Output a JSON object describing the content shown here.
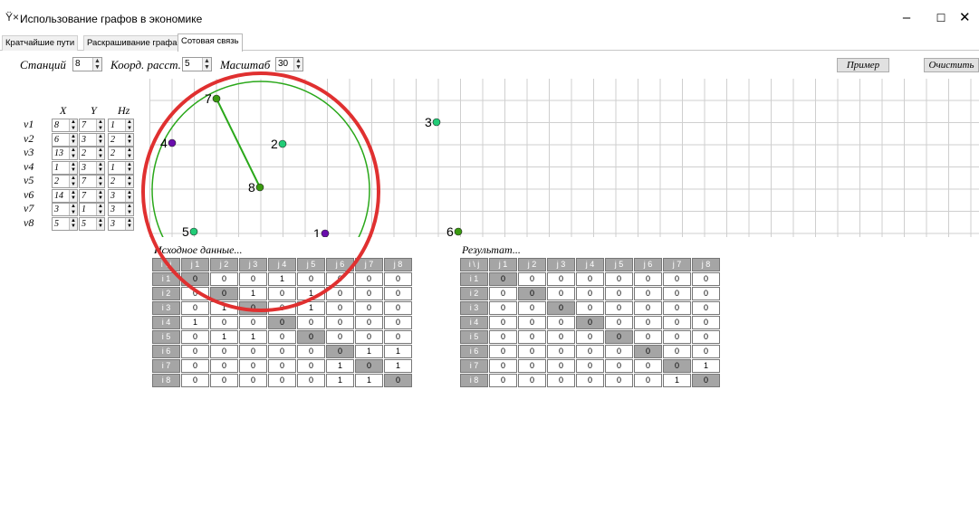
{
  "window": {
    "title": "Использование графов в экономике",
    "app_icon": "graph-app-icon",
    "minimize": "–",
    "maximize": "☐",
    "close": "✕"
  },
  "tabs": [
    "Кратчайшие пути",
    "Раскрашивание графа",
    "Сотовая связь"
  ],
  "active_tab": 2,
  "controls": {
    "stations_label": "Станций",
    "stations_value": "8",
    "coord_label": "Коорд. расст.",
    "coord_value": "5",
    "scale_label": "Масштаб",
    "scale_value": "30",
    "example_button": "Пример",
    "clear_button": "Очистить"
  },
  "coords": {
    "headers": [
      "X",
      "Y",
      "Hz"
    ],
    "rows": [
      {
        "label": "v1",
        "x": "8",
        "y": "7",
        "hz": "1"
      },
      {
        "label": "v2",
        "x": "6",
        "y": "3",
        "hz": "2"
      },
      {
        "label": "v3",
        "x": "13",
        "y": "2",
        "hz": "2"
      },
      {
        "label": "v4",
        "x": "1",
        "y": "3",
        "hz": "1"
      },
      {
        "label": "v5",
        "x": "2",
        "y": "7",
        "hz": "2"
      },
      {
        "label": "v6",
        "x": "14",
        "y": "7",
        "hz": "3"
      },
      {
        "label": "v7",
        "x": "3",
        "y": "1",
        "hz": "3"
      },
      {
        "label": "v8",
        "x": "5",
        "y": "5",
        "hz": "3"
      }
    ]
  },
  "graph": {
    "nodes": [
      {
        "label": "1",
        "color": "#6a0dad"
      },
      {
        "label": "2",
        "color": "#22cc77"
      },
      {
        "label": "3",
        "color": "#22cc77"
      },
      {
        "label": "4",
        "color": "#6a0dad"
      },
      {
        "label": "5",
        "color": "#22cc77"
      },
      {
        "label": "6",
        "color": "#3a9a10"
      },
      {
        "label": "7",
        "color": "#3a9a10"
      },
      {
        "label": "8",
        "color": "#3a9a10"
      }
    ],
    "edges": [
      [
        "7",
        "8"
      ]
    ],
    "circle_color": "#2aa81a",
    "highlight_color": "#e03030"
  },
  "source": {
    "caption": "Исходное данные...",
    "corner": "i \\ j",
    "col_headers": [
      "j 1",
      "j 2",
      "j 3",
      "j 4",
      "j 5",
      "j 6",
      "j 7",
      "j 8"
    ],
    "row_headers": [
      "i 1",
      "i 2",
      "i 3",
      "i 4",
      "i 5",
      "i 6",
      "i 7",
      "i 8"
    ],
    "rows": [
      [
        "0",
        "0",
        "0",
        "1",
        "0",
        "0",
        "0",
        "0"
      ],
      [
        "0",
        "0",
        "1",
        "0",
        "1",
        "0",
        "0",
        "0"
      ],
      [
        "0",
        "1",
        "0",
        "0",
        "1",
        "0",
        "0",
        "0"
      ],
      [
        "1",
        "0",
        "0",
        "0",
        "0",
        "0",
        "0",
        "0"
      ],
      [
        "0",
        "1",
        "1",
        "0",
        "0",
        "0",
        "0",
        "0"
      ],
      [
        "0",
        "0",
        "0",
        "0",
        "0",
        "0",
        "1",
        "1"
      ],
      [
        "0",
        "0",
        "0",
        "0",
        "0",
        "1",
        "0",
        "1"
      ],
      [
        "0",
        "0",
        "0",
        "0",
        "0",
        "1",
        "1",
        "0"
      ]
    ]
  },
  "result": {
    "caption": "Результат...",
    "corner": "i \\ j",
    "col_headers": [
      "j 1",
      "j 2",
      "j 3",
      "j 4",
      "j 5",
      "j 6",
      "j 7",
      "j 8"
    ],
    "row_headers": [
      "i 1",
      "i 2",
      "i 3",
      "i 4",
      "i 5",
      "i 6",
      "i 7",
      "i 8"
    ],
    "rows": [
      [
        "0",
        "0",
        "0",
        "0",
        "0",
        "0",
        "0",
        "0"
      ],
      [
        "0",
        "0",
        "0",
        "0",
        "0",
        "0",
        "0",
        "0"
      ],
      [
        "0",
        "0",
        "0",
        "0",
        "0",
        "0",
        "0",
        "0"
      ],
      [
        "0",
        "0",
        "0",
        "0",
        "0",
        "0",
        "0",
        "0"
      ],
      [
        "0",
        "0",
        "0",
        "0",
        "0",
        "0",
        "0",
        "0"
      ],
      [
        "0",
        "0",
        "0",
        "0",
        "0",
        "0",
        "0",
        "0"
      ],
      [
        "0",
        "0",
        "0",
        "0",
        "0",
        "0",
        "0",
        "1"
      ],
      [
        "0",
        "0",
        "0",
        "0",
        "0",
        "0",
        "1",
        "0"
      ]
    ]
  }
}
